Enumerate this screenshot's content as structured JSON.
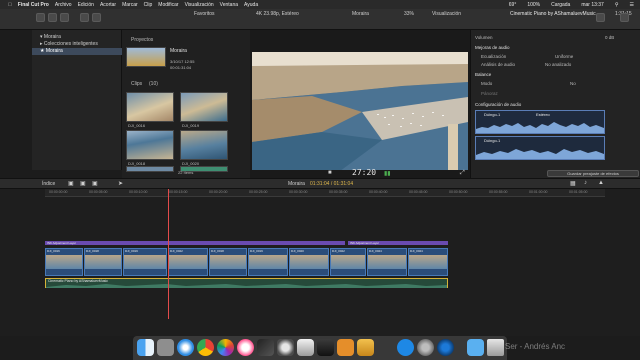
{
  "menubar": {
    "app_name": "Final Cut Pro",
    "menus": [
      "Archivo",
      "Edición",
      "Acortar",
      "Marcar",
      "Clip",
      "Modificar",
      "Visualización",
      "Ventana",
      "Ayuda"
    ],
    "status": {
      "battery": "100%",
      "charging": "Cargada",
      "clock": "mar 13:37",
      "wifi_level": "69°"
    }
  },
  "toolbar": {
    "favorites_label": "Favoritos",
    "format_label": "4K 23.98p, Estéreo",
    "project_label": "Moraira",
    "zoom_label": "33%",
    "view_label": "Visualización",
    "inspector_title": "Cinematic Piano by AShamaluevMusic",
    "inspector_time": "1:31:15"
  },
  "libraries": {
    "items": [
      {
        "label": "Moraira"
      },
      {
        "label": "Colecciones inteligentes"
      },
      {
        "label": "Moraira"
      }
    ]
  },
  "browser": {
    "projects_header": "Proyectos",
    "project": {
      "name": "Moraira",
      "date": "3/10/17 12:55",
      "duration": "00:01:31:04"
    },
    "clips_header": "Clips",
    "clips_count": "(10)",
    "clips": [
      {
        "label": "DJI_0016"
      },
      {
        "label": "DJI_0019"
      },
      {
        "label": "DJI_0018"
      },
      {
        "label": "DJI_0020"
      }
    ],
    "items_count": "22 ítems"
  },
  "viewer": {
    "timecode": "27:20"
  },
  "inspector": {
    "volume_label": "Volumen",
    "volume_value": "0 dB",
    "enhancements_header": "Mejoras de audio",
    "eq_label": "Ecualización",
    "eq_value": "Uniforme",
    "analysis_label": "Análisis de audio",
    "analysis_value": "No analizado",
    "balance_header": "Balance",
    "mode_label": "Modo",
    "mode_value": "No",
    "pan_label": "Pánoraz",
    "config_header": "Configuración de audio",
    "channels": [
      {
        "label": "Dúingo-1",
        "value": "Estéreo"
      },
      {
        "label": "Dúingo-1"
      }
    ],
    "save_preset_label": "Guardar preajuste de efectos"
  },
  "timeline_bar": {
    "index_label": "Índice",
    "project_label": "Moraira",
    "timecode": "01:31:04 / 01:31:04"
  },
  "timeline": {
    "ruler_ticks": [
      "00:00:00:00",
      "00:00:05:00",
      "00:00:10:00",
      "00:00:15:00",
      "00:00:20:00",
      "00:00:25:00",
      "00:00:30:00",
      "00:00:35:00",
      "00:00:40:00",
      "00:00:45:00",
      "00:00:50:00",
      "00:00:55:00",
      "00:01:00:00",
      "00:01:05:00"
    ],
    "adjustment_layer": "INK Adjustment Layer",
    "adjustment_layer_2": "INK Adjustment Layer",
    "video_clips": [
      {
        "label": "DJI_0016"
      },
      {
        "label": "DJI_0018"
      },
      {
        "label": "DJI_0019"
      },
      {
        "label": "DJI_0022"
      },
      {
        "label": "DJI_0018"
      },
      {
        "label": "DJI_0019"
      },
      {
        "label": "DJI_0020"
      },
      {
        "label": "DJI_0022"
      },
      {
        "label": "DJI_0024"
      },
      {
        "label": "DJI_0024"
      }
    ],
    "audio_clip": "Cinematic Piano by AShamaluevMusic"
  },
  "dock": {
    "watermark": "Ser - Andrés Anc",
    "icons": [
      "finder-icon",
      "launchpad-icon",
      "safari-icon",
      "chrome-icon",
      "photos-icon",
      "itunes-icon",
      "final-cut-icon",
      "motion-icon",
      "compressor-icon",
      "app-store-icon",
      "system-preferences-icon",
      "folder-icon",
      "trash-icon"
    ]
  }
}
